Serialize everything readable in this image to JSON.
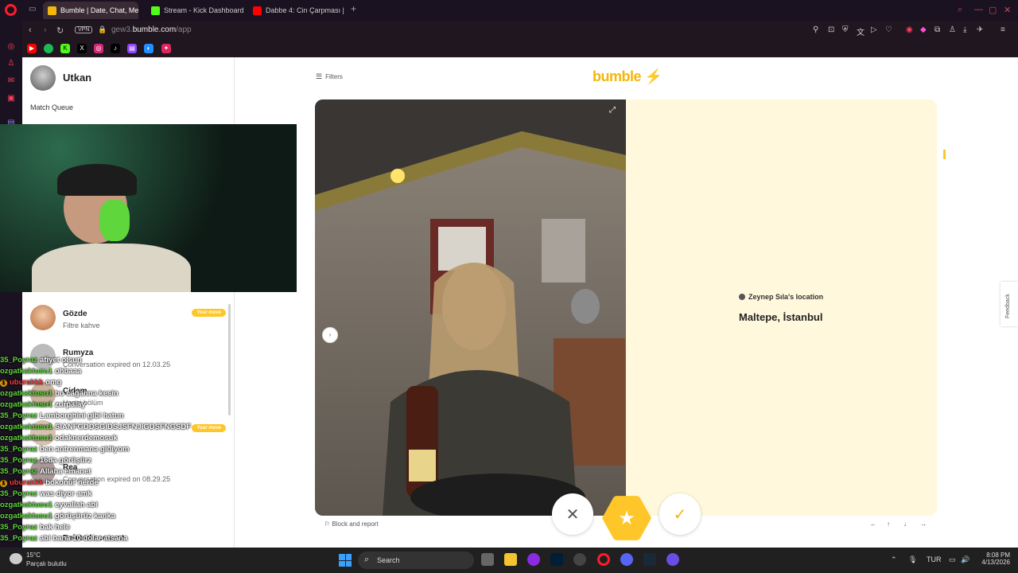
{
  "browser": {
    "tabs": [
      {
        "label": "Bumble | Date, Chat, Meet",
        "active": true,
        "favicon_color": "#f3b60b"
      },
      {
        "label": "Stream - Kick Dashboard",
        "active": false,
        "favicon_color": "#53fc18"
      },
      {
        "label": "Dabbe 4: Cin Çarpması | 4",
        "active": false,
        "favicon_color": "#ff0000"
      }
    ],
    "vpn_label": "VPN",
    "url_prefix": "gew3.",
    "url_domain": "bumble.com",
    "url_path": "/app",
    "bookmarks": [
      "youtube-icon",
      "spotify-icon",
      "kick-icon",
      "x-icon",
      "instagram-icon",
      "tiktok-icon",
      "twitch-icon",
      "discord-icon",
      "game-icon"
    ]
  },
  "sidebar": {
    "user_name": "Utkan",
    "match_queue_label": "Match Queue",
    "conversations": [
      {
        "name": "Gözde",
        "subtitle": "Filtre kahve",
        "badge": "Your move"
      },
      {
        "name": "Rumyza",
        "subtitle": "Conversation expired on 12.03.25",
        "badge": ""
      },
      {
        "name": "Çidem",
        "subtitle": "Hangi bölüm",
        "badge": ""
      },
      {
        "name": "",
        "subtitle": "",
        "badge": "Your move"
      },
      {
        "name": "Rea",
        "subtitle": "Conversation expired on 08.29.25",
        "badge": ""
      },
      {
        "name": "Deleted account",
        "subtitle": "",
        "badge": ""
      }
    ]
  },
  "main": {
    "filters_label": "Filters",
    "logo_text": "bumble",
    "location_title": "Zeynep Sıla's location",
    "location_value": "Maltepe, İstanbul",
    "block_report_label": "Block and report",
    "feedback_label": "Feedback",
    "keyboard_hints": [
      "←",
      "↑",
      "↓",
      "→"
    ]
  },
  "chat_overlay": [
    {
      "user": "35_Poyraz",
      "msg": "afiyet olsun",
      "color": "#5fd63b",
      "badge": ""
    },
    {
      "user": "ozgatkaktusu1",
      "msg": "ohbaaa",
      "color": "#5fd63b",
      "badge": ""
    },
    {
      "user": "uburakkk",
      "msg": "omg",
      "color": "#ff3b3b",
      "badge": "1"
    },
    {
      "user": "ozgatkaktusu1",
      "msg": "bu cağanna kesin",
      "color": "#5fd63b",
      "badge": ""
    },
    {
      "user": "ozgatkaktusu1",
      "msg": "zurpalay",
      "color": "#5fd63b",
      "badge": ""
    },
    {
      "user": "35_Poyraz",
      "msg": "Lamborghini gibi hatun",
      "color": "#5fd63b",
      "badge": ""
    },
    {
      "user": "ozgatkaktusu1",
      "msg": "SIANFGDDSGIDSJSFNJIGDSFNGSDF",
      "color": "#5fd63b",
      "badge": ""
    },
    {
      "user": "ozgatkaktusu1",
      "msg": "odaknerdemosuk",
      "color": "#5fd63b",
      "badge": ""
    },
    {
      "user": "35_Poyraz",
      "msg": "ben antrenmana gidiyom",
      "color": "#5fd63b",
      "badge": ""
    },
    {
      "user": "35_Poyraz",
      "msg": "16da görüşürz",
      "color": "#5fd63b",
      "badge": ""
    },
    {
      "user": "35_Poyraz",
      "msg": "Allaha emanet",
      "color": "#5fd63b",
      "badge": ""
    },
    {
      "user": "uburakkk",
      "msg": "bokonur nerde",
      "color": "#ff3b3b",
      "badge": "1"
    },
    {
      "user": "35_Poyraz",
      "msg": "was diyor amk",
      "color": "#5fd63b",
      "badge": ""
    },
    {
      "user": "ozgatkaktusu1",
      "msg": "eyvallah abi",
      "color": "#5fd63b",
      "badge": ""
    },
    {
      "user": "ozgatkaktusu1",
      "msg": "görüşürüz kanka",
      "color": "#5fd63b",
      "badge": ""
    },
    {
      "user": "35_Poyraz",
      "msg": "bak hele",
      "color": "#5fd63b",
      "badge": ""
    },
    {
      "user": "35_Poyraz",
      "msg": "abi bana 10 dolar atsana",
      "color": "#5fd63b",
      "badge": ""
    }
  ],
  "taskbar": {
    "temperature": "15°C",
    "weather_desc": "Parçalı bulutlu",
    "search_label": "Search",
    "language": "TUR",
    "time": "8:08 PM",
    "date": "4/13/2026"
  }
}
